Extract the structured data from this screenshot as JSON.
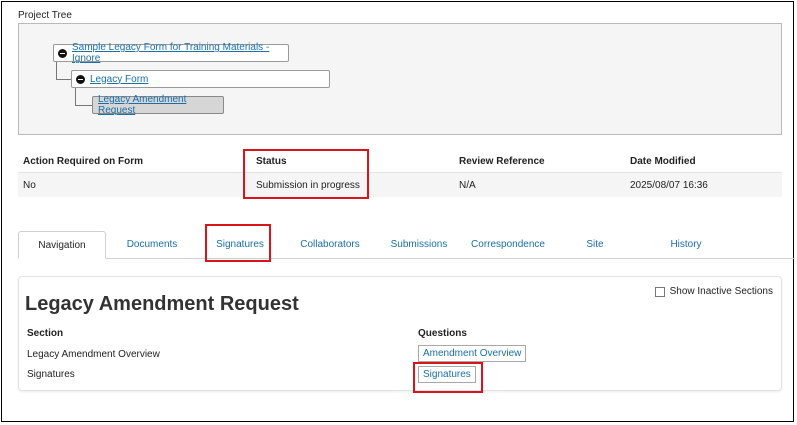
{
  "project_tree": {
    "label": "Project Tree",
    "nodes": [
      {
        "label": "Sample Legacy Form for Training Materials - Ignore"
      },
      {
        "label": "Legacy Form"
      },
      {
        "label": "Legacy Amendment Request"
      }
    ]
  },
  "info_table": {
    "headers": [
      "Action Required on Form",
      "Status",
      "Review Reference",
      "Date Modified"
    ],
    "row": [
      "No",
      "Submission in progress",
      "N/A",
      "2025/08/07 16:36"
    ]
  },
  "tabs": [
    {
      "label": "Navigation",
      "active": true
    },
    {
      "label": "Documents"
    },
    {
      "label": "Signatures"
    },
    {
      "label": "Collaborators"
    },
    {
      "label": "Submissions"
    },
    {
      "label": "Correspondence"
    },
    {
      "label": "Site"
    },
    {
      "label": "History"
    }
  ],
  "section": {
    "title": "Legacy Amendment Request",
    "show_inactive_label": "Show Inactive Sections",
    "col_section": "Section",
    "col_questions": "Questions",
    "rows": [
      {
        "section": "Legacy Amendment Overview",
        "question": "Amendment Overview"
      },
      {
        "section": "Signatures",
        "question": "Signatures"
      }
    ]
  },
  "colors": {
    "link": "#1a6fa8",
    "highlight": "#d9141b"
  }
}
